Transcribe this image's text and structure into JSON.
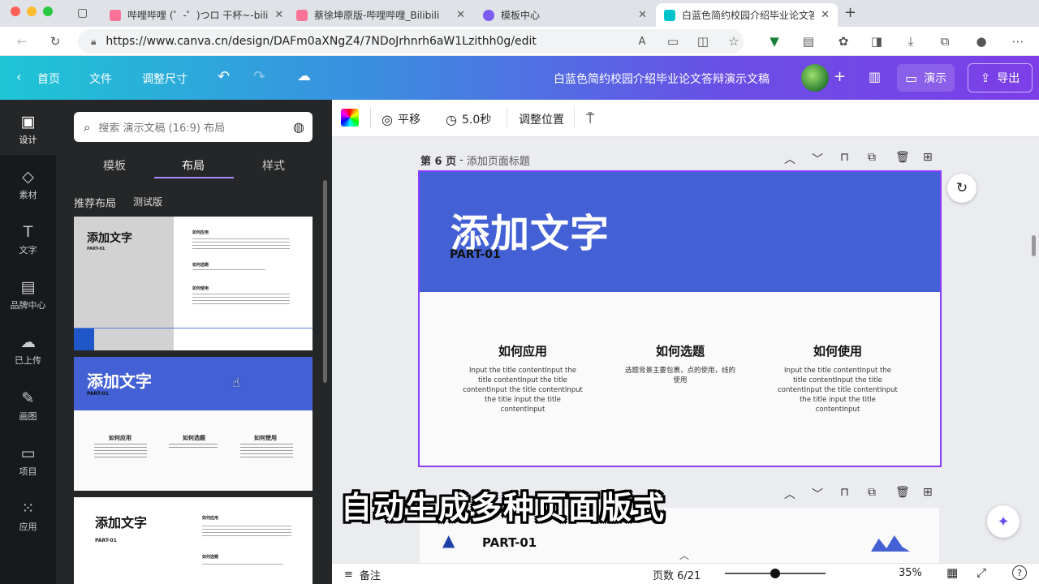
{
  "browser": {
    "tabs": [
      {
        "title": "哔哩哔哩 (゜-゜)つロ 干杯~-bili",
        "color": "#fb7299"
      },
      {
        "title": "蔡徐坤原版-哔哩哔哩_Bilibili",
        "color": "#fb7299"
      },
      {
        "title": "模板中心",
        "color": "#7d5bf0"
      },
      {
        "title": "白蓝色简约校园介绍毕业论文答辩",
        "color": "#00c4cc"
      }
    ],
    "url": "https://www.canva.cn/design/DAFm0aXNgZ4/7NDoJrhnrh6aW1Lzithh0g/edit"
  },
  "header": {
    "home": "首页",
    "file": "文件",
    "resize": "调整尺寸",
    "doc_title": "白蓝色简约校园介绍毕业论文答辩演示文稿",
    "present": "演示",
    "export": "导出"
  },
  "rail": [
    {
      "label": "设计",
      "icon": "▣"
    },
    {
      "label": "素材",
      "icon": "◇"
    },
    {
      "label": "文字",
      "icon": "T"
    },
    {
      "label": "品牌中心",
      "icon": "▤"
    },
    {
      "label": "已上传",
      "icon": "☁"
    },
    {
      "label": "画图",
      "icon": "✎"
    },
    {
      "label": "项目",
      "icon": "▭"
    },
    {
      "label": "应用",
      "icon": "⁙"
    }
  ],
  "panel": {
    "search_placeholder": "搜索 演示文稿 (16:9) 布局",
    "tabs": [
      "模板",
      "布局",
      "样式"
    ],
    "section": "推荐布局",
    "beta": "测试版",
    "thumbs": {
      "t1_title": "添加文字",
      "part": "PART-01",
      "h_use": "如何应用",
      "h_topic": "如何选题",
      "h_how": "如何使用",
      "t2_title": "添加文字",
      "t3_title": "添加文字"
    }
  },
  "toolbar": {
    "transition": "平移",
    "duration": "5.0秒",
    "position": "调整位置"
  },
  "page": {
    "label": "第 6 页",
    "sep": "-",
    "title_hint": "添加页面标题"
  },
  "slide": {
    "title": "添加文字",
    "part": "PART-01",
    "cols": [
      {
        "h": "如何应用",
        "p": "Input the title contentInput the title contentInput the title contentInput the title contentInput the title input the title contentInput"
      },
      {
        "h": "如何选题",
        "p": "选题背景主要包裹，点的使用，线的使用"
      },
      {
        "h": "如何使用",
        "p": "Input the title contentInput the title contentInput the title contentInput the title contentInput the title input the title contentInput"
      }
    ]
  },
  "next_slide": {
    "part": "PART-01"
  },
  "caption": "自动生成多种页面版式",
  "bottom": {
    "notes": "备注",
    "pages": "页数 6/21",
    "zoom": "35%",
    "zoom_level": 0.35
  },
  "colors": {
    "accent": "#8b3dff",
    "slide_blue": "#4361d4"
  }
}
